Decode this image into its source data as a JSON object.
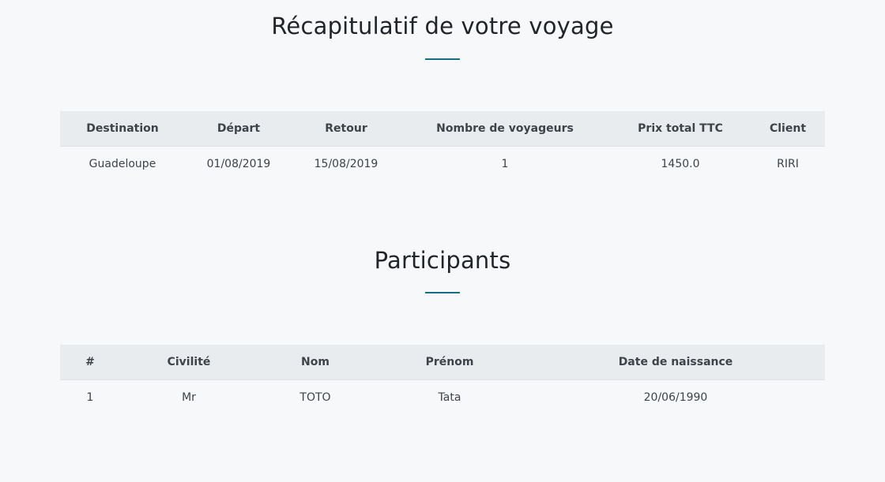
{
  "trip_summary": {
    "title": "Récapitulatif de votre voyage",
    "headers": {
      "destination": "Destination",
      "departure": "Départ",
      "return": "Retour",
      "travelers": "Nombre de voyageurs",
      "total_price": "Prix total TTC",
      "client": "Client"
    },
    "row": {
      "destination": "Guadeloupe",
      "departure": "01/08/2019",
      "return": "15/08/2019",
      "travelers": "1",
      "total_price": "1450.0",
      "client": "RIRI"
    }
  },
  "participants": {
    "title": "Participants",
    "headers": {
      "index": "#",
      "civility": "Civilité",
      "last_name": "Nom",
      "first_name": "Prénom",
      "birth_date": "Date de naissance"
    },
    "rows": [
      {
        "index": "1",
        "civility": "Mr",
        "last_name": "TOTO",
        "first_name": "Tata",
        "birth_date": "20/06/1990"
      }
    ]
  },
  "colors": {
    "accent": "#1a6a8a",
    "header_bg": "#e9ecef",
    "page_bg": "#f7f8fa"
  }
}
